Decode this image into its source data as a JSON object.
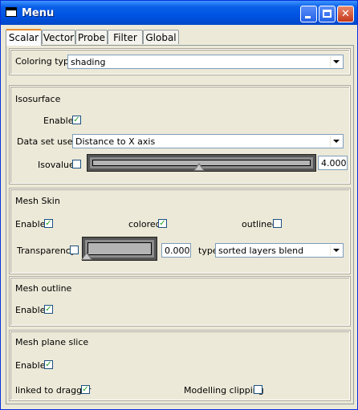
{
  "window": {
    "title": "Menu"
  },
  "tabs": [
    "Scalar",
    "Vector",
    "Probe",
    "Filter",
    "Global"
  ],
  "scalar": {
    "coloring_type_label": "Coloring type",
    "coloring_type_value": "shading"
  },
  "isosurface": {
    "title": "Isosurface",
    "enable_label": "Enable",
    "enable_checked": true,
    "dataset_label": "Data set used",
    "dataset_value": "Distance to X axis",
    "isovalue_label": "Isovalue",
    "isovalue_checked": false,
    "isovalue_slider_fraction": 0.5,
    "isovalue_value": "4.000"
  },
  "mesh_skin": {
    "title": "Mesh Skin",
    "enable_label": "Enable",
    "enable_checked": true,
    "colored_label": "colored",
    "colored_checked": true,
    "outlined_label": "outlined",
    "outlined_checked": false,
    "transparency_label": "Transparency",
    "transparency_checked": false,
    "transparency_slider_fraction": 0.0,
    "transparency_value": "0.000",
    "type_label": "type",
    "type_value": "sorted layers blend"
  },
  "mesh_outline": {
    "title": "Mesh outline",
    "enable_label": "Enable",
    "enable_checked": true
  },
  "mesh_plane_slice": {
    "title": "Mesh plane slice",
    "enable_label": "Enable",
    "enable_checked": true,
    "linked_label": "linked to dragger",
    "linked_checked": true,
    "clipping_label": "Modelling clipping",
    "clipping_checked": false
  },
  "icons": [
    "window-app-icon",
    "minimize-icon",
    "maximize-icon",
    "close-icon",
    "checkmark-icon",
    "dropdown-arrow-icon",
    "slider-thumb-icon"
  ]
}
